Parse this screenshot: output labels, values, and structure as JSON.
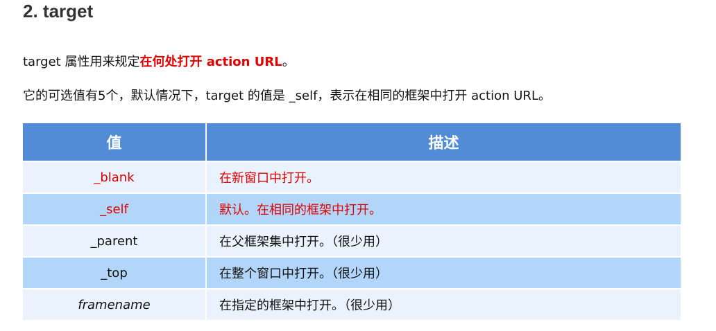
{
  "heading": "2. target",
  "intro": {
    "prefix": "target 属性用来规定",
    "emphasis": "在何处打开 action URL",
    "suffix": "。"
  },
  "description": "它的可选值有5个，默认情况下，target 的值是 _self，表示在相同的框架中打开 action URL。",
  "table": {
    "headers": [
      "值",
      "描述"
    ],
    "rows": [
      {
        "value": "_blank",
        "desc": "在新窗口中打开。"
      },
      {
        "value": "_self",
        "desc": "默认。在相同的框架中打开。"
      },
      {
        "value": "_parent",
        "desc": "在父框架集中打开。（很少用）"
      },
      {
        "value": "_top",
        "desc": "在整个窗口中打开。（很少用）"
      },
      {
        "value": "framename",
        "desc": "在指定的框架中打开。（很少用）"
      }
    ]
  },
  "colors": {
    "header_bg": "#528cd6",
    "row_light": "#eaf3fd",
    "row_dark": "#b2d6fa",
    "emphasis": "#e00000"
  }
}
